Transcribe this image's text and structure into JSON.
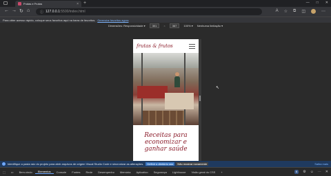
{
  "tab": {
    "title": "Frutas e Frutos",
    "close": "×",
    "new": "+"
  },
  "window": {
    "min": "—",
    "max": "□",
    "close": "✕"
  },
  "nav": {
    "back": "←",
    "forward": "→",
    "reload": "↻",
    "home": "⌂",
    "url_host": "127.0.0.1",
    "url_path": ":5500/index.html"
  },
  "favbar": {
    "message": "Para obter acesso rápido, coloque seus favoritos aqui na barra de favoritos.",
    "link": "Gerenciar favoritos agora"
  },
  "device_toolbar": {
    "device": "Dimensões: Responsividade ▾",
    "width": "301",
    "x": "×",
    "height": "367",
    "zoom": "100% ▾",
    "throttle": "Nenhuma limitação ▾"
  },
  "site": {
    "logo": "frutas & frutos",
    "headline": "Receitas para economizar e ganhar saúde"
  },
  "infobar": {
    "message": "Identifique a pasta raiz do projeto para abrir arquivos de origem Visual Studio Code e sincronizar as alterações.",
    "btn_select": "Definir o diretório raiz",
    "btn_hide": "Não mostrar novamente",
    "more": "Saiba mais"
  },
  "devtools": {
    "tabs": [
      "Bem-vindo",
      "Elementos",
      "Console",
      "Fontes",
      "Rede",
      "Desempenho",
      "Memória",
      "Aplicativo",
      "Segurança",
      "Lighthouse",
      "Visão geral do CSS"
    ],
    "active_tab": "Elementos",
    "counter": "6",
    "add": "+"
  }
}
